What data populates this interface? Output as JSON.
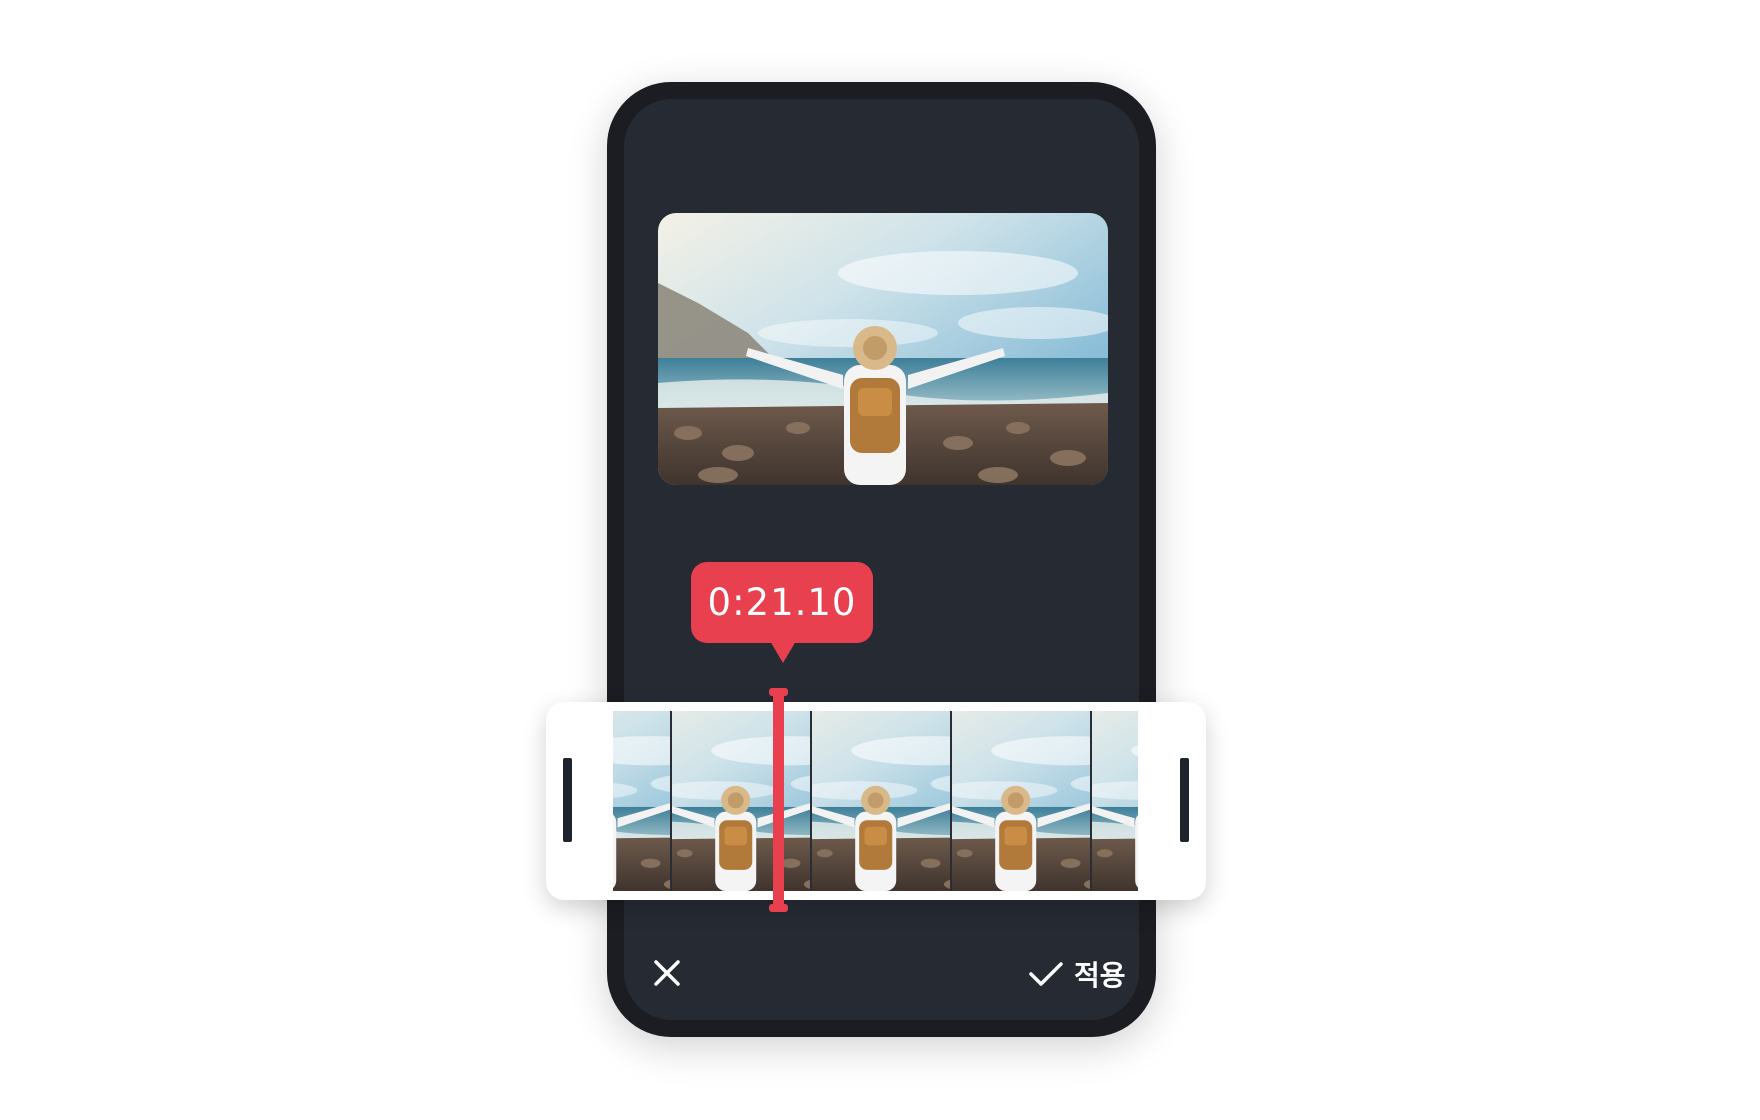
{
  "editor": {
    "current_time": "0:21.10",
    "frame_count": 5
  },
  "actions": {
    "cancel_icon": "close-icon",
    "apply_icon": "check-icon",
    "apply_label": "적용"
  },
  "colors": {
    "accent": "#e8404f",
    "screen_bg": "#262a33",
    "phone_frame": "#1b1d22",
    "timeline_bg": "#ffffff"
  }
}
